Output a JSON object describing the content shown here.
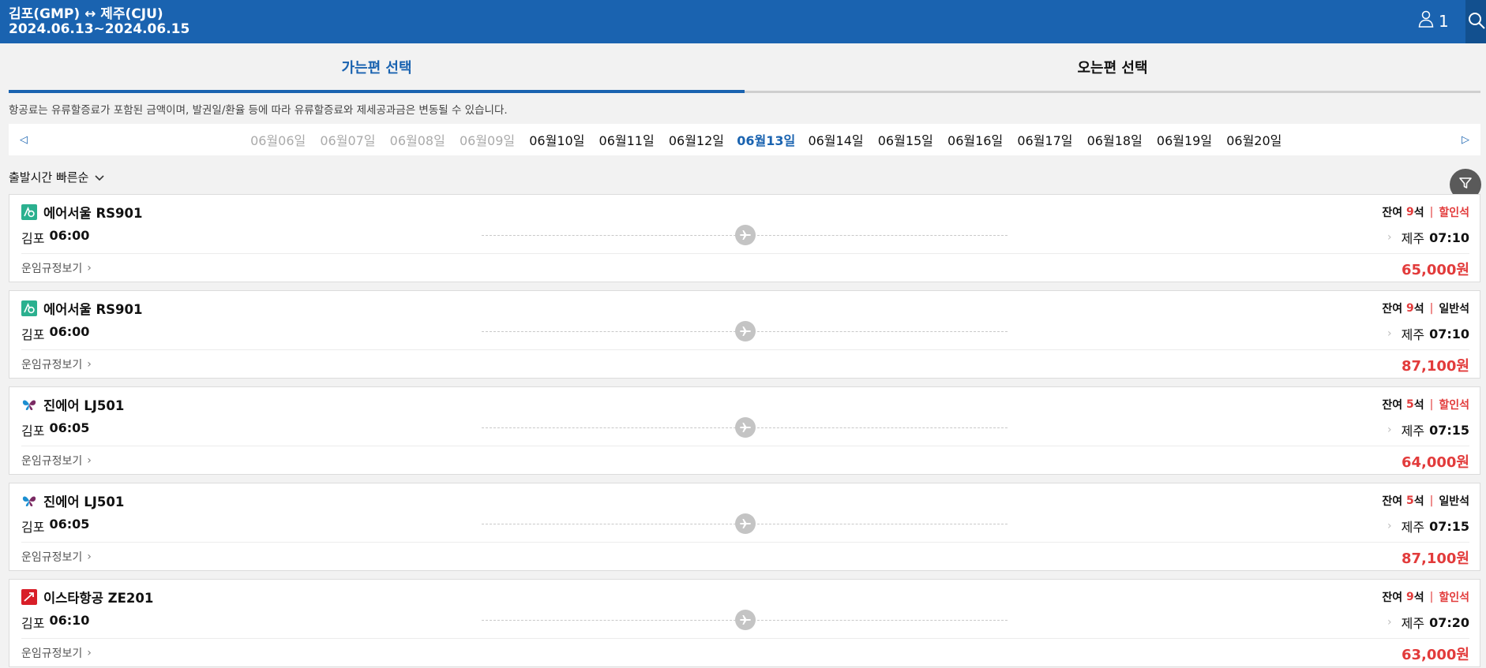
{
  "header": {
    "route": "김포(GMP) ↔ 제주(CJU)",
    "dates": "2024.06.13~2024.06.15",
    "passenger_count": "1"
  },
  "tabs": {
    "outbound": "가는편 선택",
    "return": "오는편 선택"
  },
  "notice": "항공료는 유류할증료가 포함된 금액이며, 발권일/환율 등에 따라 유류할증료와 제세공과금은 변동될 수 있습니다.",
  "date_bar": {
    "dates": [
      "06월06일",
      "06월07일",
      "06월08일",
      "06월09일",
      "06월10일",
      "06월11일",
      "06월12일",
      "06월13일",
      "06월14일",
      "06월15일",
      "06월16일",
      "06월17일",
      "06월18일",
      "06월19일",
      "06월20일"
    ],
    "disabled_count": 4,
    "selected": "06월13일"
  },
  "sort_label": "출발시간 빠른순",
  "flights": [
    {
      "airline": "에어서울 RS901",
      "logo": "rs",
      "seat_prefix": "잔여",
      "seats": "9",
      "seat_unit": "석",
      "class": "할인석",
      "discount": true,
      "dep_city": "김포",
      "dep_time": "06:00",
      "arr_city": "제주",
      "arr_time": "07:10",
      "fare_rule": "운임규정보기",
      "price": "65,000원"
    },
    {
      "airline": "에어서울 RS901",
      "logo": "rs",
      "seat_prefix": "잔여",
      "seats": "9",
      "seat_unit": "석",
      "class": "일반석",
      "discount": false,
      "dep_city": "김포",
      "dep_time": "06:00",
      "arr_city": "제주",
      "arr_time": "07:10",
      "fare_rule": "운임규정보기",
      "price": "87,100원"
    },
    {
      "airline": "진에어 LJ501",
      "logo": "lj",
      "seat_prefix": "잔여",
      "seats": "5",
      "seat_unit": "석",
      "class": "할인석",
      "discount": true,
      "dep_city": "김포",
      "dep_time": "06:05",
      "arr_city": "제주",
      "arr_time": "07:15",
      "fare_rule": "운임규정보기",
      "price": "64,000원"
    },
    {
      "airline": "진에어 LJ501",
      "logo": "lj",
      "seat_prefix": "잔여",
      "seats": "5",
      "seat_unit": "석",
      "class": "일반석",
      "discount": false,
      "dep_city": "김포",
      "dep_time": "06:05",
      "arr_city": "제주",
      "arr_time": "07:15",
      "fare_rule": "운임규정보기",
      "price": "87,100원"
    },
    {
      "airline": "이스타항공 ZE201",
      "logo": "ze",
      "seat_prefix": "잔여",
      "seats": "9",
      "seat_unit": "석",
      "class": "할인석",
      "discount": true,
      "dep_city": "김포",
      "dep_time": "06:10",
      "arr_city": "제주",
      "arr_time": "07:20",
      "fare_rule": "운임규정보기",
      "price": "63,000원"
    }
  ],
  "colors": {
    "brand_blue": "#1a63b0",
    "price_red": "#e23b3b"
  }
}
